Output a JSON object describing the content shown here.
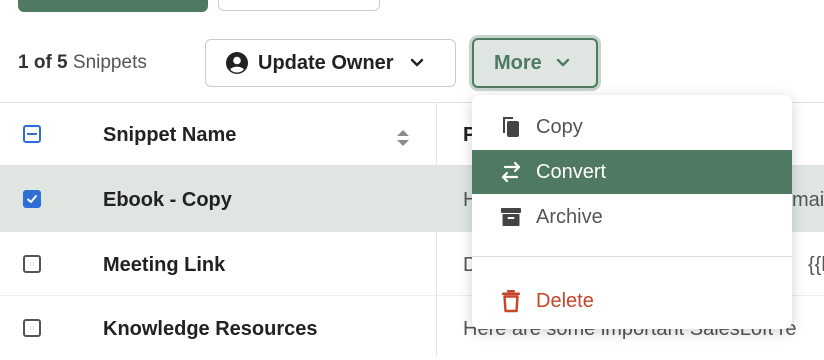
{
  "toolbar": {
    "count_number": "1 of 5",
    "count_label": "Snippets",
    "update_owner_label": "Update Owner",
    "more_label": "More"
  },
  "table": {
    "columns": [
      {
        "label": "Snippet Name",
        "sortable": true
      },
      {
        "label": "P"
      }
    ],
    "rows": [
      {
        "name": "Ebook - Copy",
        "checked": true,
        "selected": true,
        "preview": "H",
        "preview_tail": "mail"
      },
      {
        "name": "Meeting Link",
        "checked": false,
        "preview": "D",
        "preview_tail": "{{l"
      },
      {
        "name": "Knowledge Resources",
        "checked": false,
        "preview": "Here are some important SalesLoft re"
      }
    ]
  },
  "more_menu": {
    "items": [
      {
        "label": "Copy",
        "icon": "copy-icon"
      },
      {
        "label": "Convert",
        "icon": "convert-icon",
        "active": true
      },
      {
        "label": "Archive",
        "icon": "archive-icon"
      },
      {
        "label": "Delete",
        "icon": "trash-icon",
        "danger": true
      }
    ]
  },
  "colors": {
    "brand": "#4f7a61",
    "checkbox": "#2e6ed6",
    "danger": "#c8452a",
    "selected_row": "#dfe6e2"
  }
}
